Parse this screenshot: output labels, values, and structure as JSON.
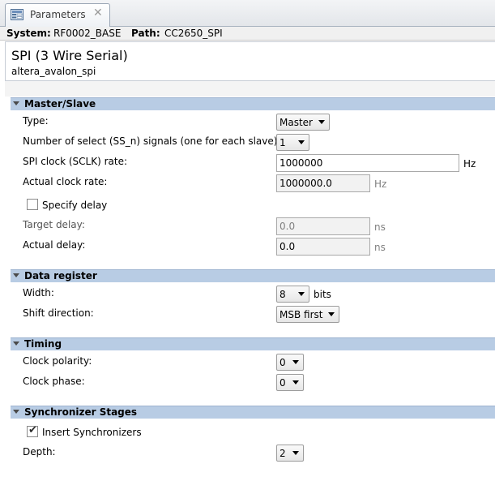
{
  "tab": {
    "label": "Parameters",
    "icon": "parameters-icon",
    "close_glyph": "✕"
  },
  "context": {
    "system_key": "System:",
    "system_val": "RF0002_BASE",
    "path_key": "Path:",
    "path_val": "CC2650_SPI"
  },
  "component": {
    "title": "SPI (3 Wire Serial)",
    "subtitle": "altera_avalon_spi"
  },
  "master_slave": {
    "title": "Master/Slave",
    "type_label": "Type:",
    "type_value": "Master",
    "select_label": "Number of select (SS_n) signals (one for each slave):",
    "select_value": "1",
    "sclk_label": "SPI clock (SCLK) rate:",
    "sclk_value": "1000000",
    "sclk_unit": "Hz",
    "actual_clock_label": "Actual clock rate:",
    "actual_clock_value": "1000000.0",
    "actual_clock_unit": "Hz",
    "specify_delay_label": "Specify delay",
    "specify_delay_checked": false,
    "target_delay_label": "Target delay:",
    "target_delay_value": "0.0",
    "target_delay_unit": "ns",
    "actual_delay_label": "Actual delay:",
    "actual_delay_value": "0.0",
    "actual_delay_unit": "ns"
  },
  "data_register": {
    "title": "Data register",
    "width_label": "Width:",
    "width_value": "8",
    "width_unit": "bits",
    "shift_label": "Shift direction:",
    "shift_value": "MSB first"
  },
  "timing": {
    "title": "Timing",
    "polarity_label": "Clock polarity:",
    "polarity_value": "0",
    "phase_label": "Clock phase:",
    "phase_value": "0"
  },
  "sync": {
    "title": "Synchronizer Stages",
    "insert_label": "Insert Synchronizers",
    "insert_checked": true,
    "check_glyph": "✔",
    "depth_label": "Depth:",
    "depth_value": "2"
  }
}
